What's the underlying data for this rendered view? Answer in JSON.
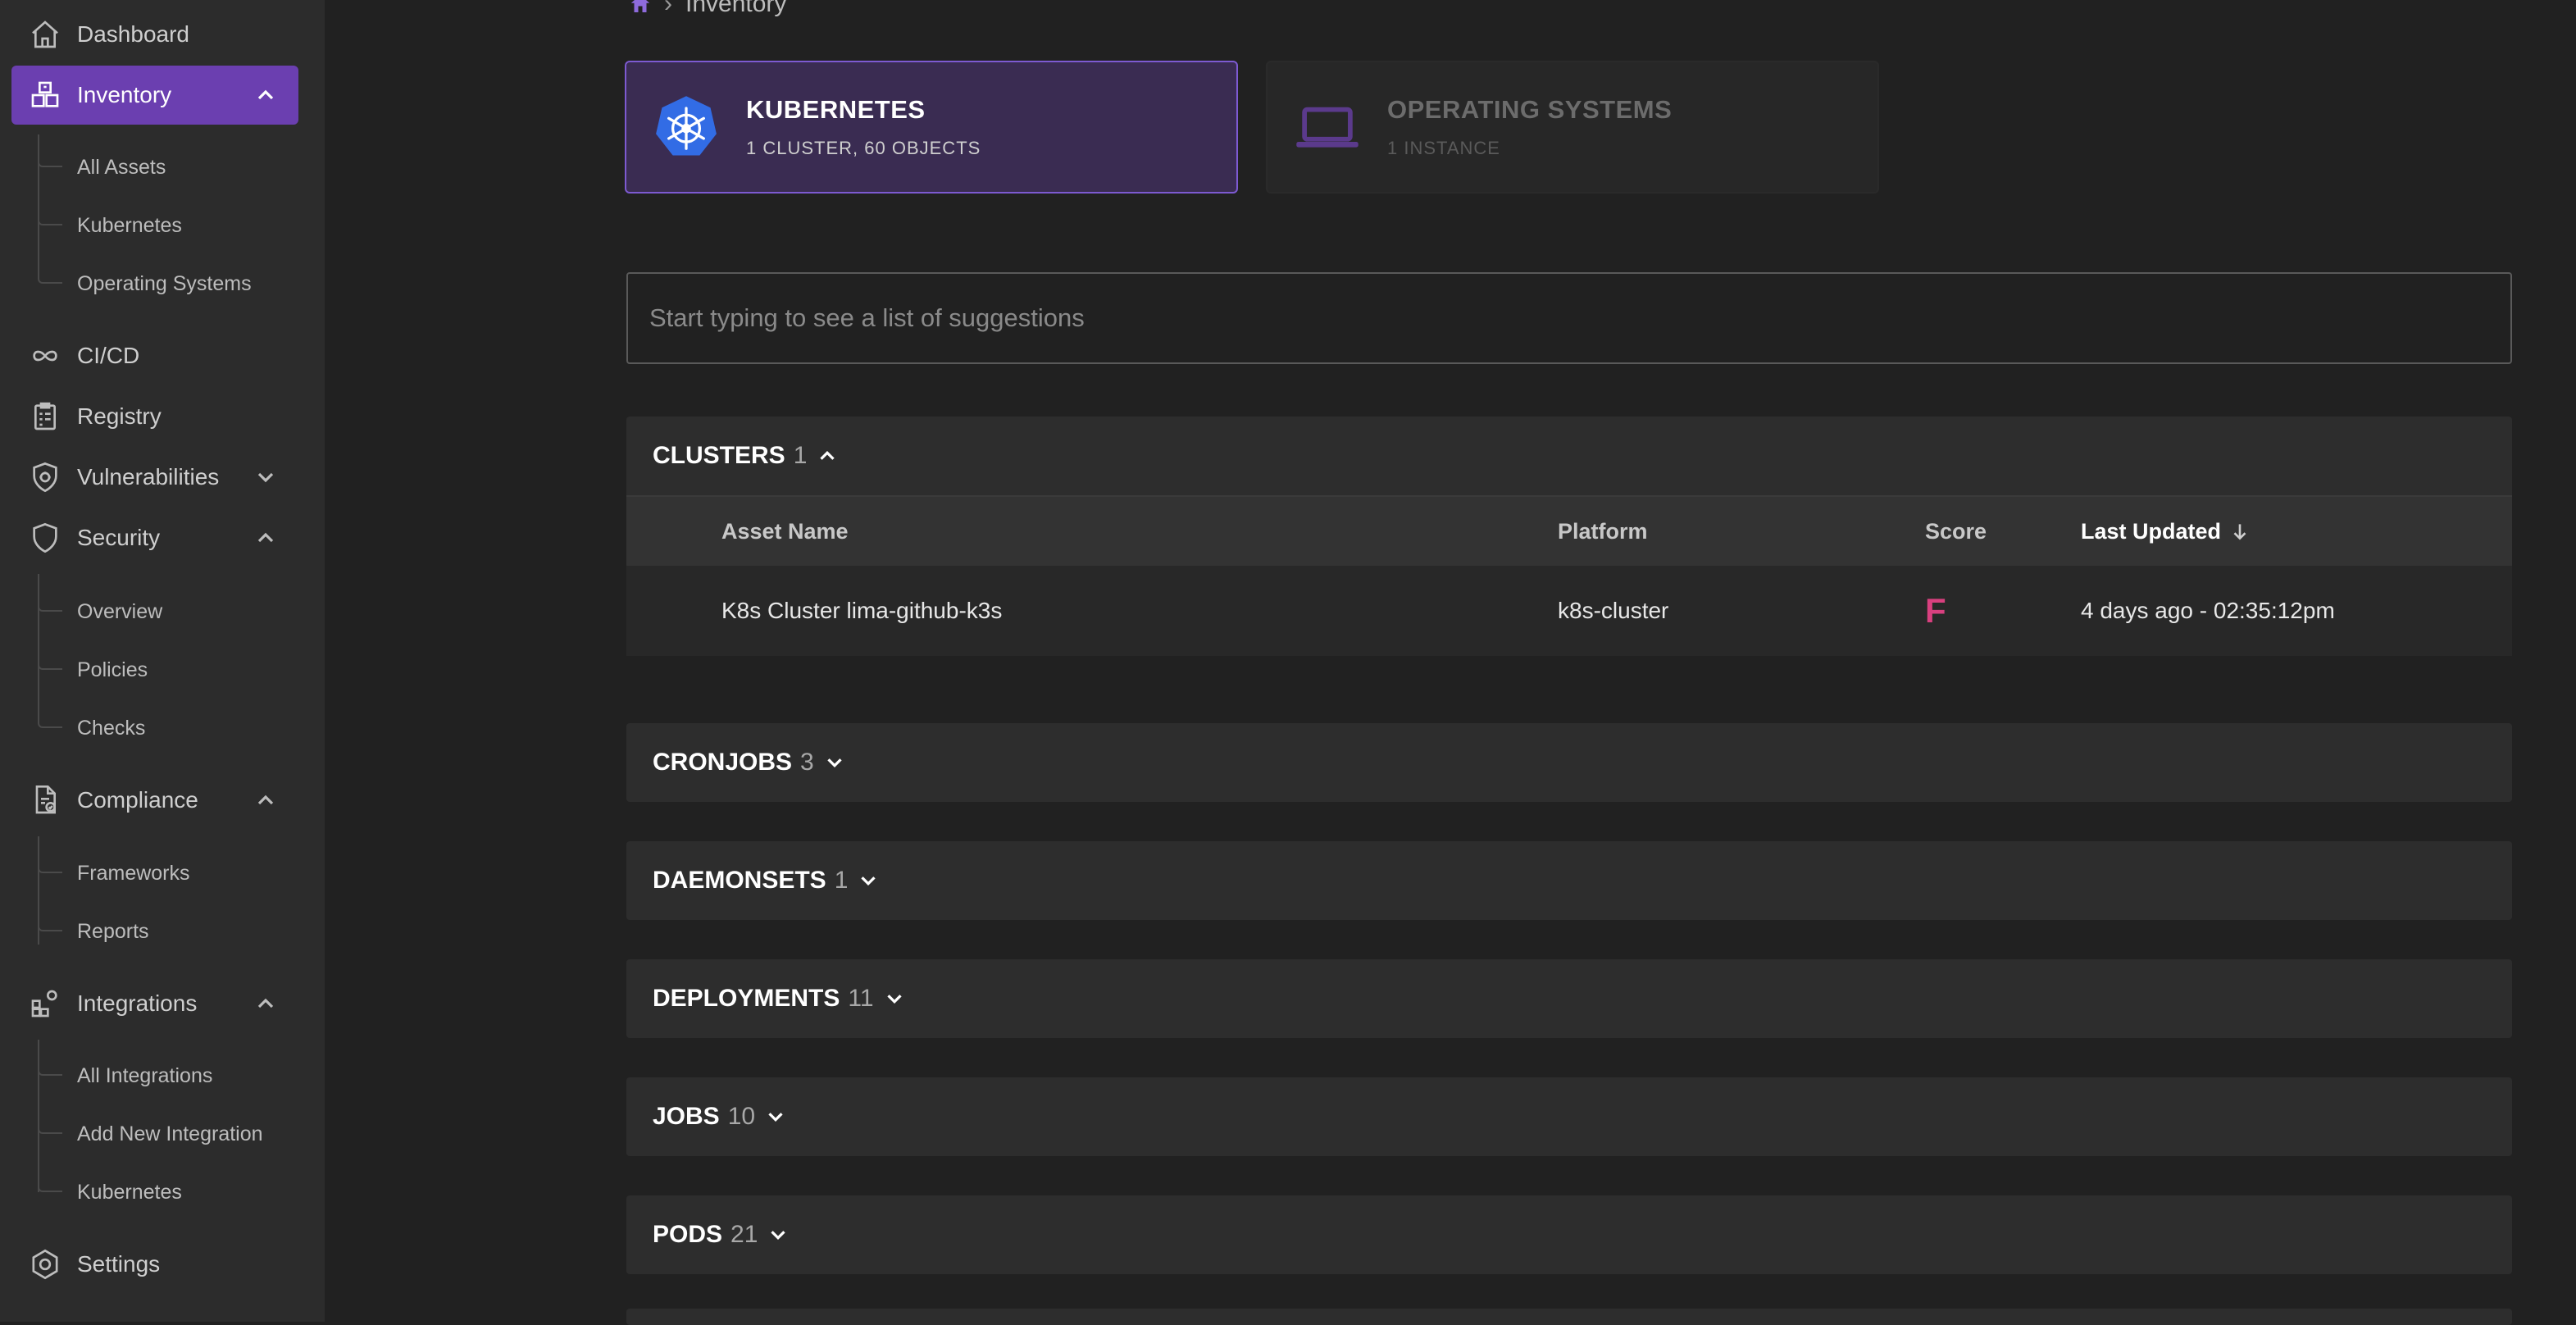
{
  "sidebar": {
    "dashboard": "Dashboard",
    "inventory": "Inventory",
    "inventory_sub": [
      "All Assets",
      "Kubernetes",
      "Operating Systems"
    ],
    "cicd": "CI/CD",
    "registry": "Registry",
    "vulnerabilities": "Vulnerabilities",
    "security": "Security",
    "security_sub": [
      "Overview",
      "Policies",
      "Checks"
    ],
    "compliance": "Compliance",
    "compliance_sub": [
      "Frameworks",
      "Reports"
    ],
    "integrations": "Integrations",
    "integrations_sub": [
      "All Integrations",
      "Add New Integration",
      "Kubernetes"
    ],
    "settings": "Settings"
  },
  "breadcrumb": {
    "sep": "›",
    "current": "Inventory"
  },
  "tiles": {
    "kubernetes": {
      "title": "KUBERNETES",
      "subtitle": "1 CLUSTER, 60 OBJECTS"
    },
    "os": {
      "title": "OPERATING SYSTEMS",
      "subtitle": "1 INSTANCE"
    }
  },
  "search": {
    "placeholder": "Start typing to see a list of suggestions"
  },
  "sections": {
    "clusters": {
      "label": "CLUSTERS",
      "count": "1"
    },
    "cronjobs": {
      "label": "CRONJOBS",
      "count": "3"
    },
    "daemonsets": {
      "label": "DAEMONSETS",
      "count": "1"
    },
    "deployments": {
      "label": "DEPLOYMENTS",
      "count": "11"
    },
    "jobs": {
      "label": "JOBS",
      "count": "10"
    },
    "pods": {
      "label": "PODS",
      "count": "21"
    }
  },
  "table": {
    "headers": {
      "asset_name": "Asset Name",
      "platform": "Platform",
      "score": "Score",
      "last_updated": "Last Updated"
    },
    "rows": [
      {
        "asset_name": "K8s Cluster lima-github-k3s",
        "platform": "k8s-cluster",
        "score": "F",
        "last_updated": "4 days ago - 02:35:12pm"
      }
    ]
  },
  "colors": {
    "accent": "#6b3fb0",
    "score_f": "#d9407f",
    "k8s_blue": "#326ce5"
  }
}
